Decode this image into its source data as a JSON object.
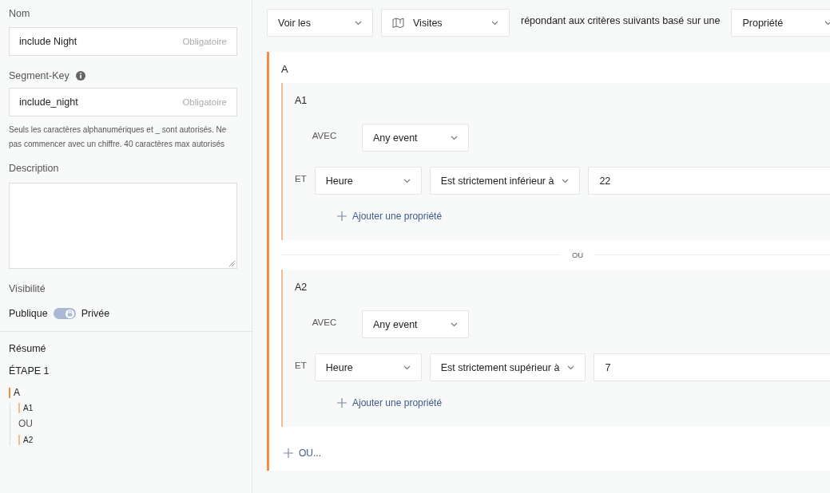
{
  "sidebar": {
    "name": {
      "label": "Nom",
      "value": "include Night",
      "hint": "Obligatoire"
    },
    "key": {
      "label": "Segment-Key",
      "value": "include_night",
      "hint": "Obligatoire",
      "help": "Seuls les caractères alphanumériques et _ sont autorisés. Ne pas commencer avec un chiffre. 40 caractères max autorisés"
    },
    "description": {
      "label": "Description"
    },
    "visibility": {
      "label": "Visibilité",
      "left": "Publique",
      "right": "Privée",
      "on": true
    },
    "summary": {
      "title": "Résumé",
      "step": "ÉTAPE 1",
      "tree": [
        {
          "label": "A",
          "kind": "group",
          "children": [
            {
              "label": "A1",
              "kind": "group"
            },
            {
              "label": "OU",
              "kind": "separator"
            },
            {
              "label": "A2",
              "kind": "group"
            }
          ]
        }
      ]
    }
  },
  "toolbar": {
    "show": "Voir les",
    "entity": "Visites",
    "sentence": "répondant aux critères suivants basé sur une",
    "basis": "Propriété"
  },
  "groups": [
    {
      "label": "A",
      "or_label": "OU",
      "add_or": "OU...",
      "subgroups": [
        {
          "label": "A1",
          "add_label": "Ajouter une propriété",
          "conditions": [
            {
              "kind": "event",
              "label": "AVEC",
              "event": "Any event"
            },
            {
              "kind": "property",
              "label": "ET",
              "property": "Heure",
              "operator": "Est strictement inférieur à",
              "value": "22"
            }
          ]
        },
        {
          "label": "A2",
          "add_label": "Ajouter une propriété",
          "conditions": [
            {
              "kind": "event",
              "label": "AVEC",
              "event": "Any event"
            },
            {
              "kind": "property",
              "label": "ET",
              "property": "Heure",
              "operator": "Est strictement supérieur à",
              "value": "7"
            }
          ]
        }
      ]
    }
  ]
}
